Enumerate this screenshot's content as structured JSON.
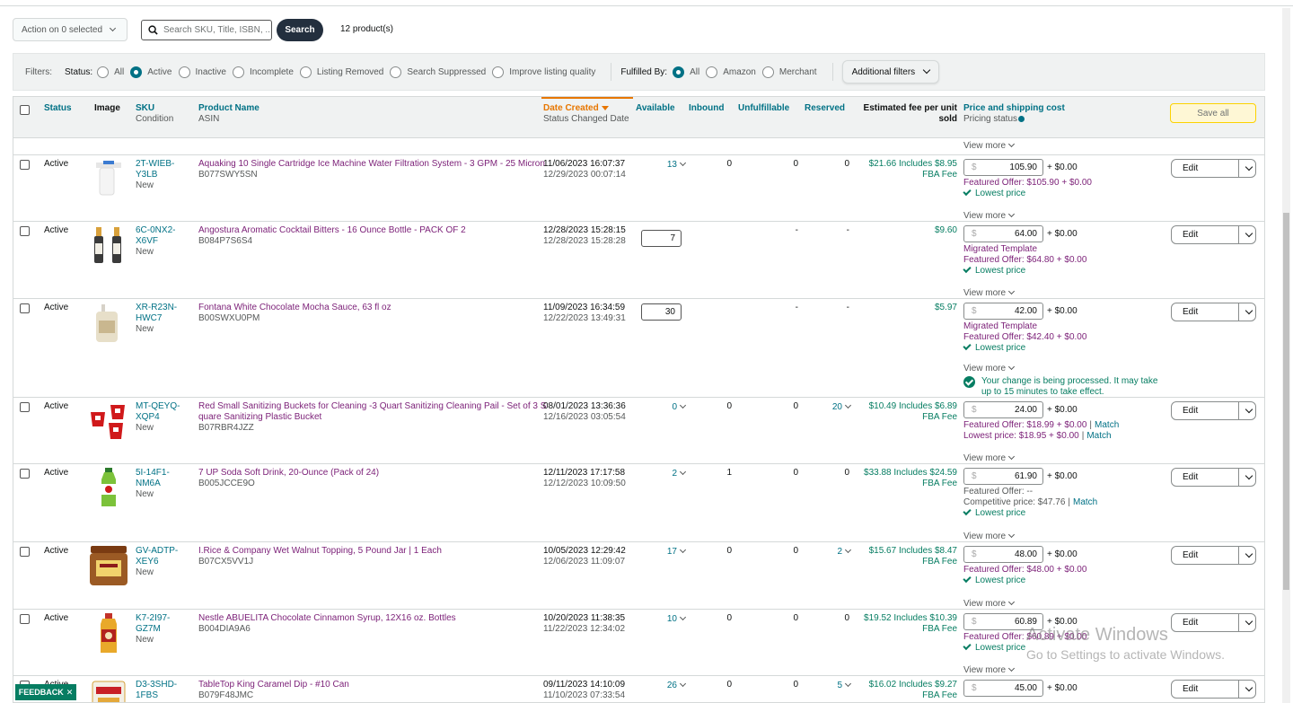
{
  "toolbar": {
    "action_label": "Action on 0 selected",
    "search_placeholder": "Search SKU, Title, ISBN, ...",
    "search_button": "Search",
    "product_count": "12 product(s)"
  },
  "filters": {
    "label": "Filters:",
    "status_label": "Status:",
    "status_options": [
      {
        "label": "All",
        "selected": false
      },
      {
        "label": "Active",
        "selected": true
      },
      {
        "label": "Inactive",
        "selected": false
      },
      {
        "label": "Incomplete",
        "selected": false
      },
      {
        "label": "Listing Removed",
        "selected": false
      },
      {
        "label": "Search Suppressed",
        "selected": false
      },
      {
        "label": "Improve listing quality",
        "selected": false
      }
    ],
    "fulfilled_label": "Fulfilled By:",
    "fulfilled_options": [
      {
        "label": "All",
        "selected": true
      },
      {
        "label": "Amazon",
        "selected": false
      },
      {
        "label": "Merchant",
        "selected": false
      }
    ],
    "additional_filters": "Additional filters"
  },
  "table": {
    "headers": {
      "status": "Status",
      "image": "Image",
      "sku": "SKU",
      "sku_sub": "Condition",
      "product": "Product Name",
      "product_sub": "ASIN",
      "date": "Date Created",
      "date_sub": "Status Changed Date",
      "available": "Available",
      "inbound": "Inbound",
      "unfulfillable": "Unfulfillable",
      "reserved": "Reserved",
      "fee": "Estimated fee per unit",
      "fee_line2": "sold",
      "price": "Price and shipping cost",
      "price_sub": "Pricing status",
      "save_all": "Save all"
    },
    "view_more": "View more",
    "edit_label": "Edit",
    "rows": [
      {
        "status": "Active",
        "sku1": "2T-WIEB-",
        "sku2": "Y3LB",
        "condition": "New",
        "title1": "Aquaking 10 Single Cartridge Ice Machine Water Filtration System - 3 GPM - 25 Micron",
        "title2": "",
        "asin": "B077SWY5SN",
        "date_created": "11/06/2023 16:07:37",
        "date_changed": "12/29/2023 00:07:14",
        "available": "13",
        "inbound": "0",
        "unfulfillable": "0",
        "reserved": "0",
        "fee1": "$21.66 Includes $8.95",
        "fee2": "FBA Fee",
        "price": "105.90",
        "shipping": "+ $0.00",
        "line_a": "Featured Offer: $105.90 + $0.00",
        "line_b": "Lowest price"
      },
      {
        "status": "Active",
        "sku1": "6C-0NX2-",
        "sku2": "X6VF",
        "condition": "New",
        "title1": "Angostura Aromatic Cocktail Bitters - 16 Ounce Bottle - PACK OF 2",
        "title2": "",
        "asin": "B084P7S6S4",
        "date_created": "12/28/2023 15:28:15",
        "date_changed": "12/28/2023 15:28:28",
        "available": "7",
        "inbound": "",
        "unfulfillable": "-",
        "reserved": "-",
        "fee1": "$9.60",
        "fee2": "",
        "price": "64.00",
        "shipping": "+ $0.00",
        "line_pre": "Migrated Template",
        "line_a": "Featured Offer: $64.80 + $0.00",
        "line_b": "Lowest price"
      },
      {
        "status": "Active",
        "sku1": "XR-R23N-",
        "sku2": "HWC7",
        "condition": "New",
        "title1": "Fontana White Chocolate Mocha Sauce, 63 fl oz",
        "title2": "",
        "asin": "B00SWXU0PM",
        "date_created": "11/09/2023 16:34:59",
        "date_changed": "12/22/2023 13:49:31",
        "available": "30",
        "inbound": "",
        "unfulfillable": "-",
        "reserved": "-",
        "fee1": "$5.97",
        "fee2": "",
        "price": "42.00",
        "shipping": "+ $0.00",
        "line_pre": "Migrated Template",
        "line_a": "Featured Offer: $42.40 + $0.00",
        "line_b": "Lowest price",
        "processing1": "Your change is being processed. It may take",
        "processing2": "up to 15 minutes to take effect."
      },
      {
        "status": "Active",
        "sku1": "MT-QEYQ-",
        "sku2": "XQP4",
        "condition": "New",
        "title1": "Red Small Sanitizing Buckets for Cleaning -3 Quart Sanitizing Cleaning Pail - Set of 3 S",
        "title2": "quare Sanitizing Plastic Bucket",
        "asin": "B07RBR4JZZ",
        "date_created": "08/01/2023 13:36:36",
        "date_changed": "12/16/2023 03:05:54",
        "available": "0",
        "inbound": "0",
        "unfulfillable": "0",
        "reserved": "20",
        "fee1": "$10.49 Includes $6.89",
        "fee2": "FBA Fee",
        "price": "24.00",
        "shipping": "+ $0.00",
        "line_a": "Featured Offer: $18.99 + $0.00",
        "line_a_match": "Match",
        "line_c": "Lowest price: $18.95 + $0.00",
        "line_c_match": "Match"
      },
      {
        "status": "Active",
        "sku1": "5I-14F1-",
        "sku2": "NM6A",
        "condition": "New",
        "title1": "7 UP Soda Soft Drink, 20-Ounce (Pack of 24)",
        "title2": "",
        "asin": "B005JCCE9O",
        "date_created": "12/11/2023 17:17:58",
        "date_changed": "12/12/2023 10:09:50",
        "available": "2",
        "inbound": "1",
        "unfulfillable": "0",
        "reserved": "0",
        "fee1": "$33.88 Includes $24.59",
        "fee2": "FBA Fee",
        "price": "61.90",
        "shipping": "+ $0.00",
        "line_grey": "Featured Offer: --",
        "line_c": "Competitive price: $47.76",
        "line_c_match": "Match",
        "line_b": "Lowest price"
      },
      {
        "status": "Active",
        "sku1": "GV-ADTP-",
        "sku2": "XEY6",
        "condition": "New",
        "title1": "I.Rice & Company Wet Walnut Topping, 5 Pound Jar | 1 Each",
        "title2": "",
        "asin": "B07CX5VV1J",
        "date_created": "10/05/2023 12:29:42",
        "date_changed": "12/06/2023 11:09:07",
        "available": "17",
        "inbound": "0",
        "unfulfillable": "0",
        "reserved": "2",
        "fee1": "$15.67 Includes $8.47",
        "fee2": "FBA Fee",
        "price": "48.00",
        "shipping": "+ $0.00",
        "line_a": "Featured Offer: $48.00 + $0.00",
        "line_b": "Lowest price"
      },
      {
        "status": "Active",
        "sku1": "K7-2I97-",
        "sku2": "GZ7M",
        "condition": "New",
        "title1": "Nestle ABUELITA Chocolate Cinnamon Syrup, 12X16 oz. Bottles",
        "title2": "",
        "asin": "B004DIA9A6",
        "date_created": "10/20/2023 11:38:35",
        "date_changed": "11/22/2023 12:34:02",
        "available": "10",
        "inbound": "0",
        "unfulfillable": "0",
        "reserved": "0",
        "fee1": "$19.52 Includes $10.39",
        "fee2": "FBA Fee",
        "price": "60.89",
        "shipping": "+ $0.00",
        "line_a": "Featured Offer: $60.89 + $0.00",
        "line_b": "Lowest price"
      },
      {
        "status": "Active",
        "sku1": "D3-3SHD-",
        "sku2": "1FBS",
        "condition": "",
        "title1": "TableTop King Caramel Dip - #10 Can",
        "title2": "",
        "asin": "B079F48JMC",
        "date_created": "09/11/2023 14:10:09",
        "date_changed": "11/10/2023 07:33:54",
        "available": "26",
        "inbound": "0",
        "unfulfillable": "0",
        "reserved": "5",
        "fee1": "$16.02 Includes $9.27",
        "fee2": "FBA Fee",
        "price": "45.00",
        "shipping": "+ $0.00"
      }
    ]
  },
  "feedback": "FEEDBACK",
  "watermark": {
    "line1": "Activate Windows",
    "line2": "Go to Settings to activate Windows."
  },
  "colors": {
    "teal": "#007185",
    "purple": "#7b1f77",
    "green": "#067d62",
    "orange": "#e77600",
    "dark": "#232f3e"
  }
}
